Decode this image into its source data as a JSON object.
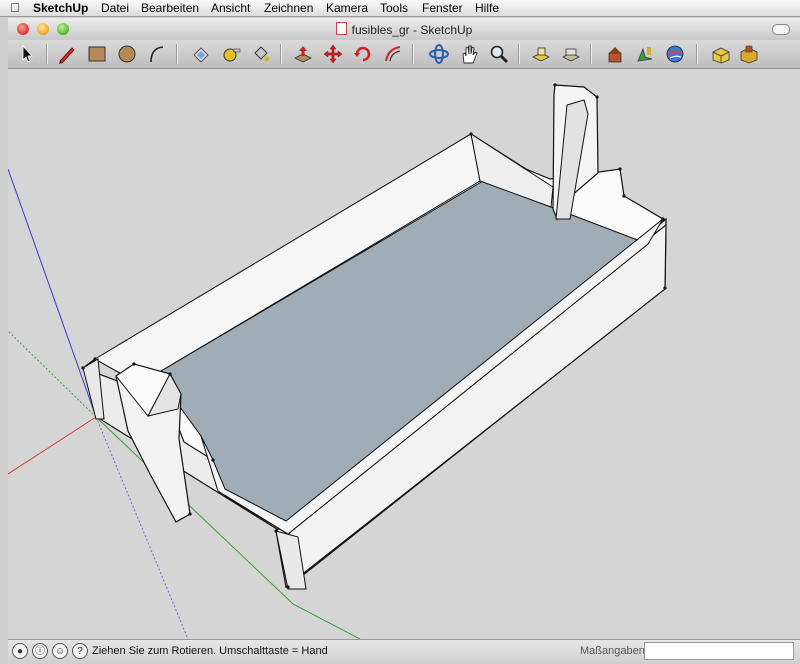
{
  "menubar": {
    "app_name": "SketchUp",
    "items": [
      "Datei",
      "Bearbeiten",
      "Ansicht",
      "Zeichnen",
      "Kamera",
      "Tools",
      "Fenster",
      "Hilfe"
    ]
  },
  "window": {
    "title": "fusibles_gr - SketchUp"
  },
  "toolbar": {
    "tools": [
      {
        "name": "select-tool-icon"
      },
      {
        "name": "pencil-line-tool-icon"
      },
      {
        "name": "rectangle-tool-icon"
      },
      {
        "name": "circle-tool-icon"
      },
      {
        "name": "arc-tool-icon"
      },
      {
        "name": "eraser-tool-icon"
      },
      {
        "name": "tape-measure-tool-icon"
      },
      {
        "name": "paint-bucket-tool-icon"
      },
      {
        "name": "push-pull-tool-icon"
      },
      {
        "name": "move-tool-icon"
      },
      {
        "name": "rotate-tool-icon"
      },
      {
        "name": "offset-tool-icon"
      },
      {
        "name": "orbit-tool-icon"
      },
      {
        "name": "pan-tool-icon"
      },
      {
        "name": "zoom-tool-icon"
      },
      {
        "name": "zoom-extents-tool-icon"
      },
      {
        "name": "previous-view-tool-icon"
      },
      {
        "name": "get-models-tool-icon"
      },
      {
        "name": "share-model-tool-icon"
      },
      {
        "name": "google-earth-tool-icon"
      },
      {
        "name": "components-tool-icon"
      },
      {
        "name": "extension-warehouse-tool-icon"
      }
    ]
  },
  "statusbar": {
    "message": "Ziehen Sie zum Rotieren.  Umschalttaste = Hand",
    "measurements_label": "Maßangaben",
    "measurements_value": "",
    "help_icon_glyph": "?"
  },
  "colors": {
    "floor": "#a1adb6",
    "wall": "#f4f4f4",
    "wall_shade": "#e6e6e6",
    "outline": "#111111",
    "axis_red": "#d23a3a",
    "axis_green": "#3aa03a",
    "axis_blue": "#3a3ad0",
    "viewport_bg": "#d5d5d5"
  }
}
